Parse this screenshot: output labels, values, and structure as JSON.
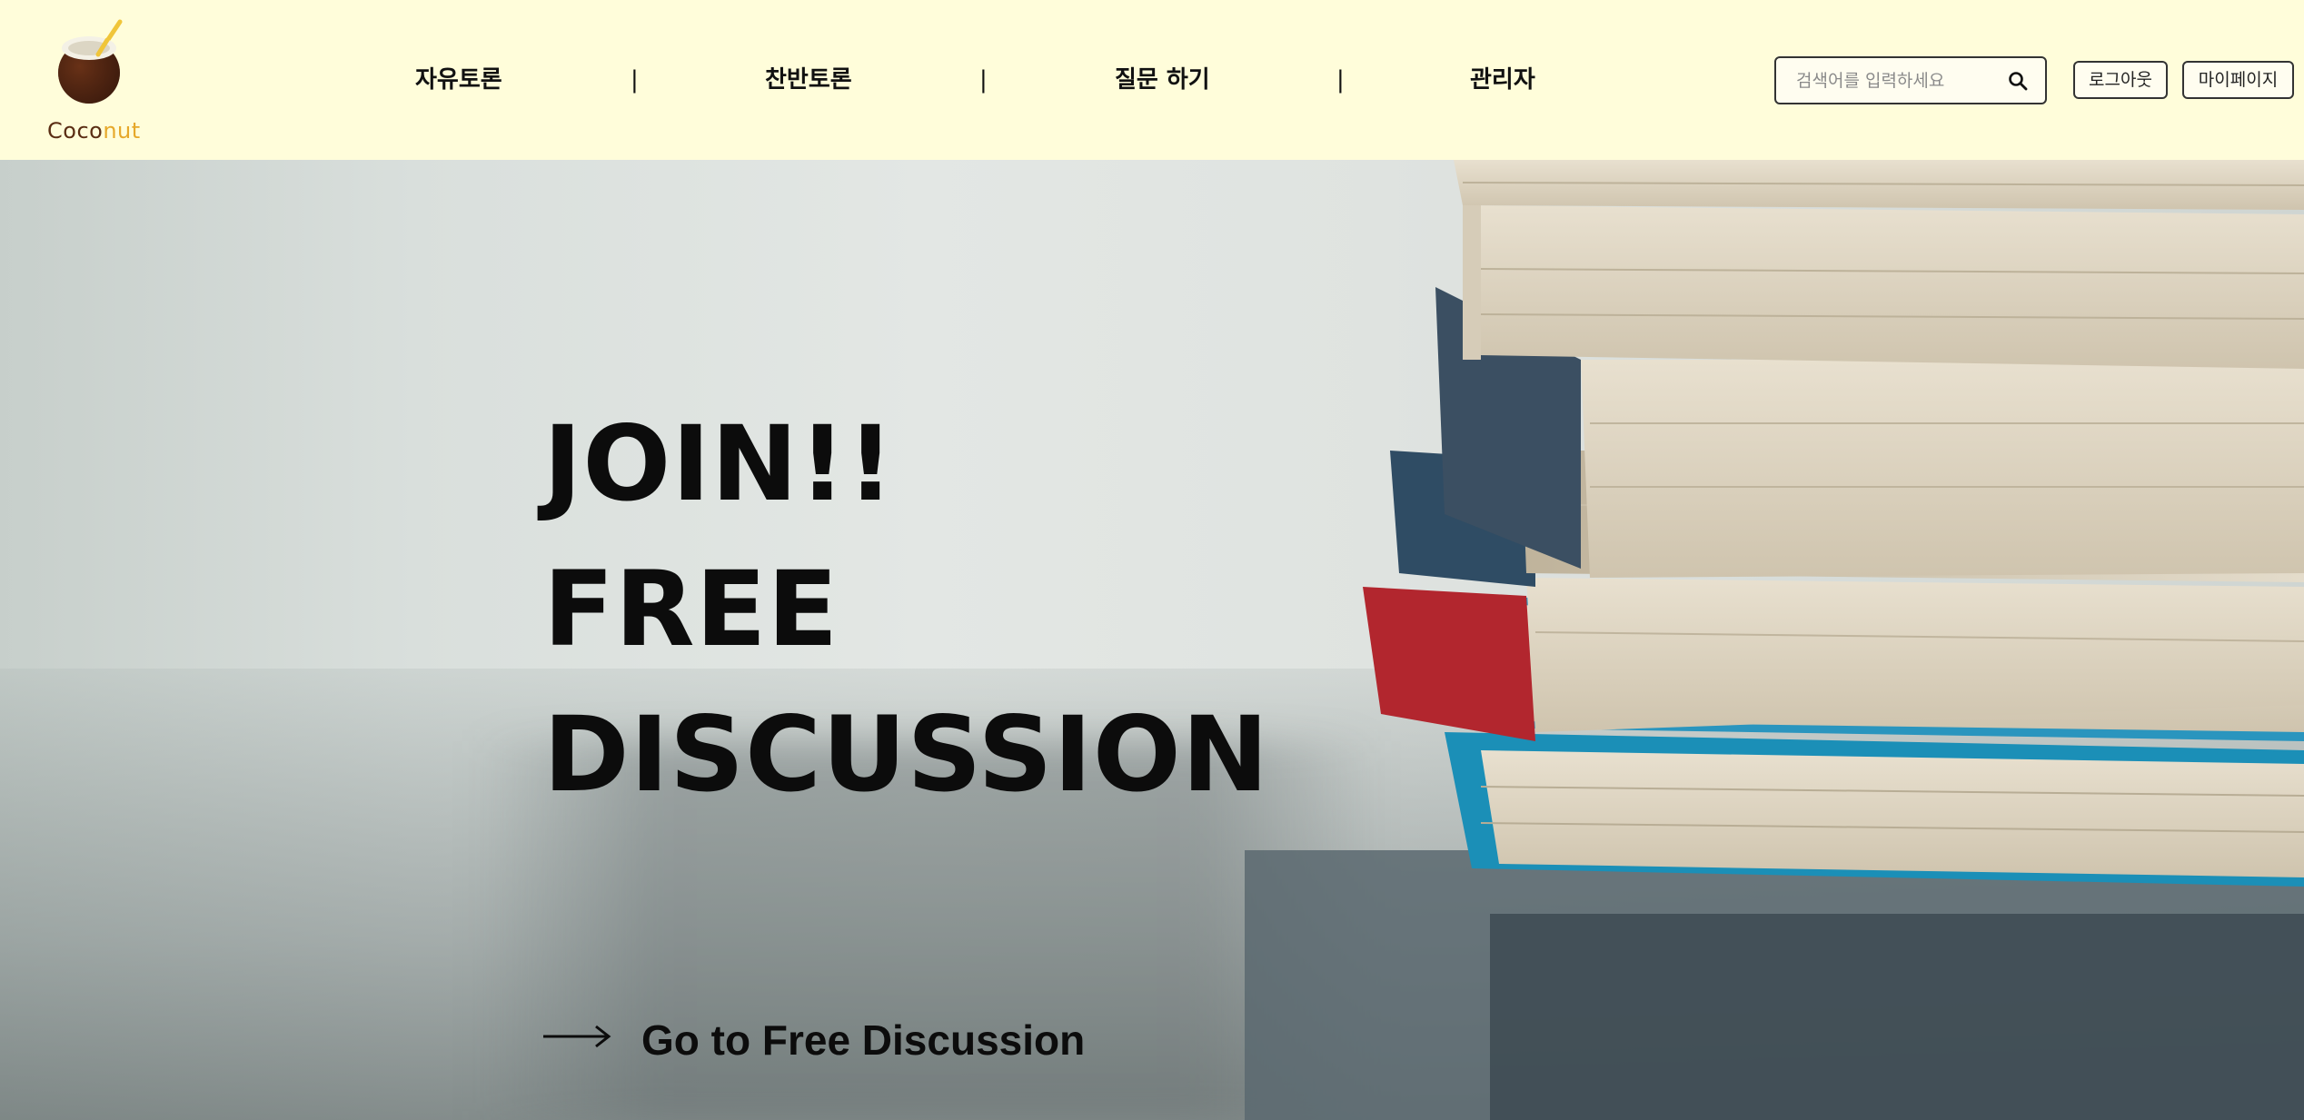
{
  "brand": {
    "name_part1": "Coco",
    "name_part2": "nut"
  },
  "nav": {
    "items": [
      {
        "label": "자유토론"
      },
      {
        "label": "찬반토론"
      },
      {
        "label": "질문 하기"
      },
      {
        "label": "관리자"
      }
    ],
    "separator": "|"
  },
  "search": {
    "placeholder": "검색어를 입력하세요",
    "value": "",
    "icon": "search-icon"
  },
  "header_buttons": {
    "logout_label": "로그아웃",
    "mypage_label": "마이페이지"
  },
  "hero": {
    "line1": "JOIN!!",
    "line2": "FREE",
    "line3": "DISCUSSION",
    "cta_label": "Go to Free Discussion",
    "cta_icon": "long-arrow-right-icon"
  },
  "colors": {
    "header_bg": "#fffdda",
    "brand_dark": "#5a2d13",
    "brand_accent": "#e6a82a",
    "text": "#0c0c0c"
  }
}
